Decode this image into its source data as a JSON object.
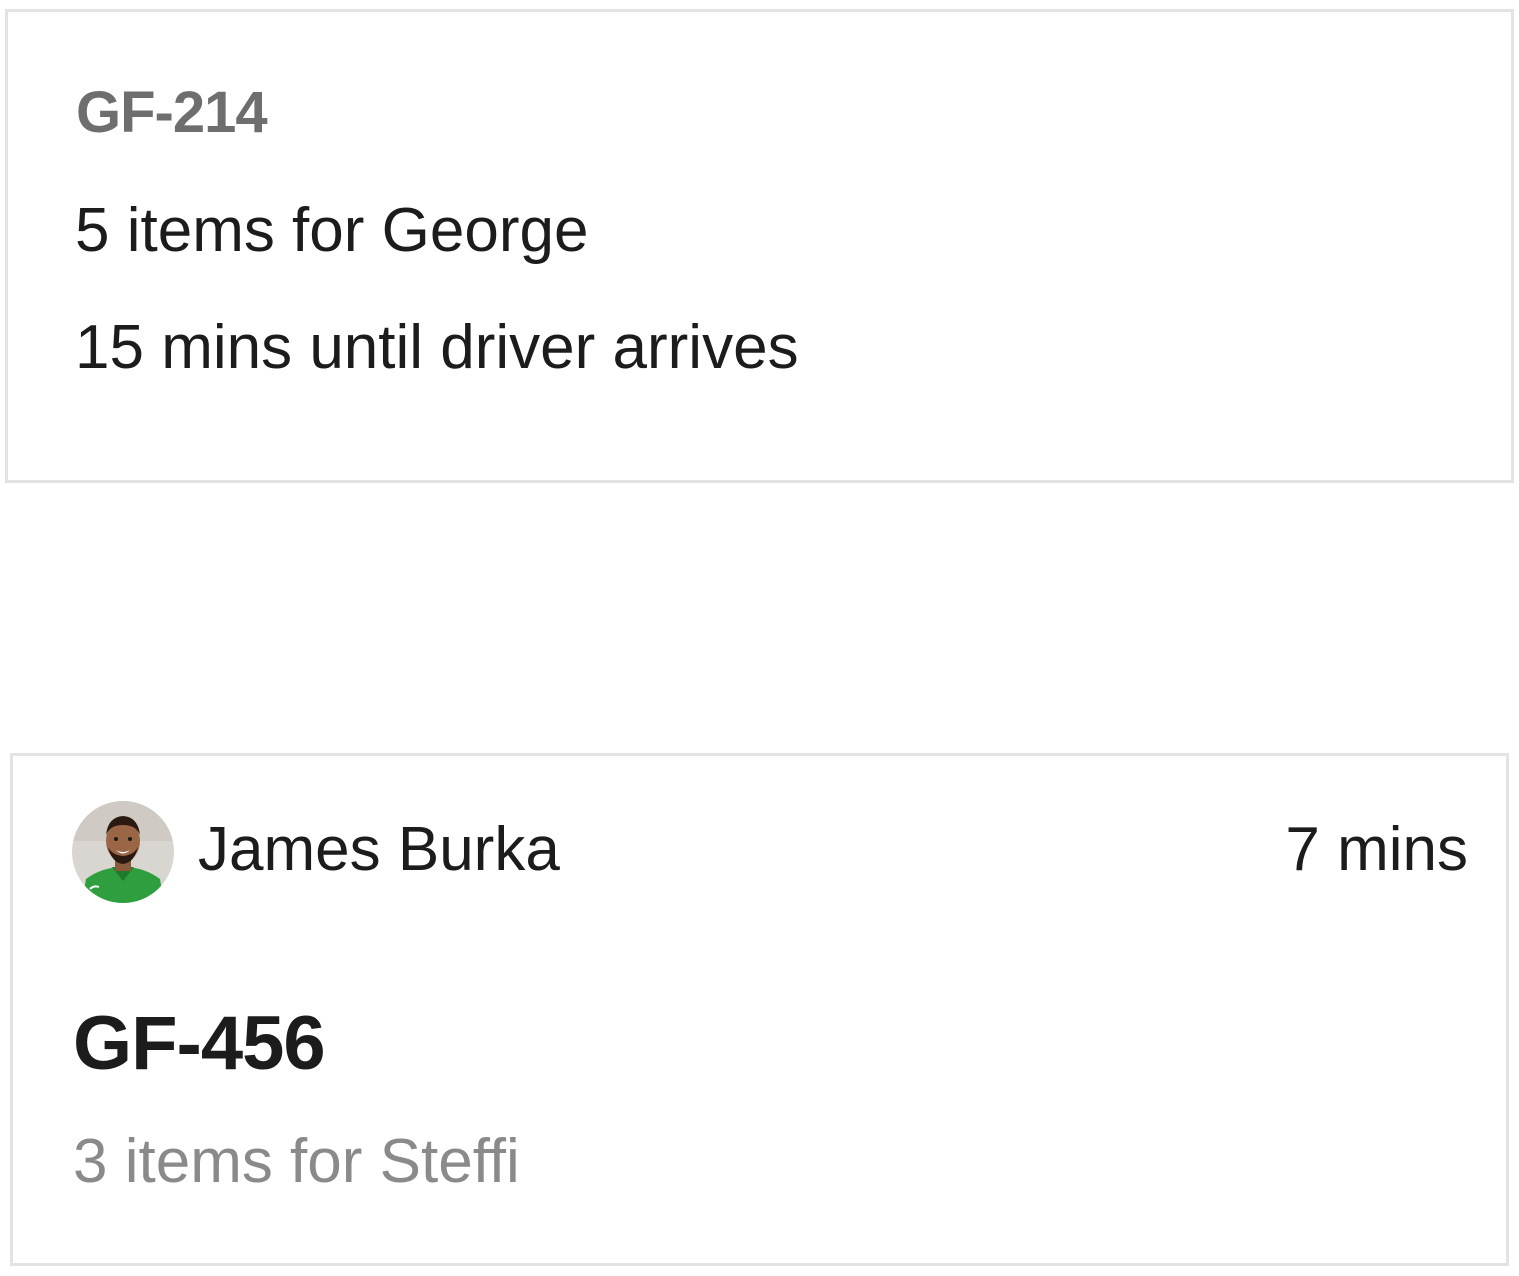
{
  "orders": [
    {
      "order_id": "GF-214",
      "items_text": "5 items for George",
      "eta_text": "15 mins until driver arrives"
    },
    {
      "driver": {
        "name": "James Burka",
        "avatar_icon": "driver-photo"
      },
      "time_text": "7 mins",
      "order_id": "GF-456",
      "items_text": "3 items for Steffi"
    }
  ],
  "colors": {
    "border": "#e3e3e3",
    "text_primary": "#1c1c1c",
    "text_muted": "#8a8a8a",
    "order_id_muted": "#6e6e6e",
    "driver_jacket": "#2e9e3e"
  }
}
